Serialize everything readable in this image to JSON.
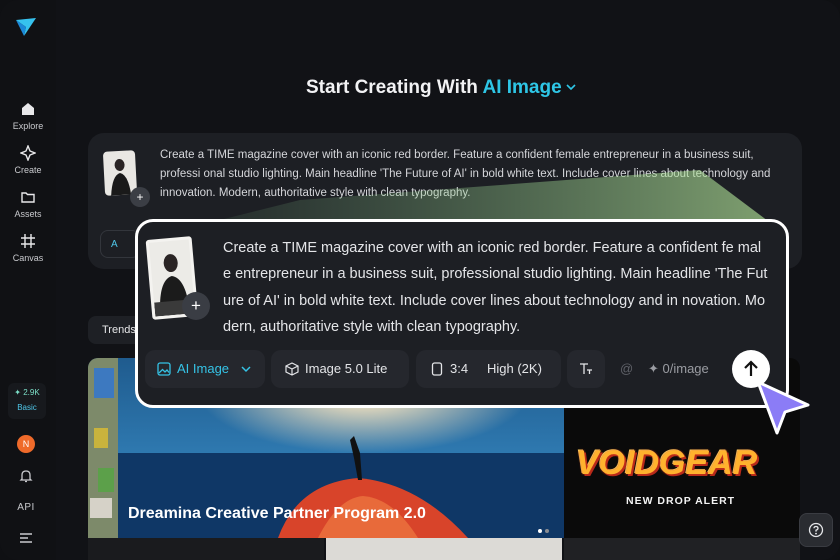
{
  "sidebar": {
    "items": [
      {
        "label": "Explore"
      },
      {
        "label": "Create"
      },
      {
        "label": "Assets"
      },
      {
        "label": "Canvas"
      }
    ],
    "credits": {
      "value": "2.9K",
      "plan": "Basic"
    },
    "avatar_initial": "N",
    "api_label": "API"
  },
  "header": {
    "title_prefix": "Start Creating With",
    "title_accent": "AI Image"
  },
  "prompt": {
    "text_small": "Create a TIME magazine cover with an iconic red border. Feature a confident female entrepreneur in a business suit, professi onal studio lighting. Main headline 'The Future of AI' in bold white text. Include cover lines about technology and innovation. Modern, authoritative style with clean typography.",
    "text_big": "Create a TIME magazine cover with an iconic red border. Feature a confident fe male entrepreneur in a business suit, professional studio lighting. Main headline 'The Future of AI' in bold white text. Include cover lines about technology and in novation. Modern, authoritative style with clean typography.",
    "plus": "+"
  },
  "toolbar": {
    "mode_label": "AI Image",
    "mode_label_partial": "A",
    "model_label": "Image 5.0 Lite",
    "ratio_label": "3:4",
    "quality_label": "High (2K)",
    "at_symbol": "@",
    "rate_label": "0/image"
  },
  "tabs": {
    "trends_label": "Trends"
  },
  "banner": {
    "title": "Dreamina Creative Partner Program 2.0",
    "side_title": "VOIDGEAR",
    "side_subtitle": "NEW DROP ALERT"
  },
  "colors": {
    "accent": "#2ec6e6",
    "cursor": "#8b7cf6",
    "card": "#1d1f24",
    "background": "#111216"
  },
  "icons": [
    "logo-icon",
    "home-icon",
    "sparkle-icon",
    "folder-icon",
    "canvas-icon",
    "bell-icon",
    "menu-icon",
    "image-icon",
    "chevron-down-icon",
    "cube-icon",
    "ratio-icon",
    "text-size-icon",
    "arrow-up-icon",
    "help-icon",
    "cursor-icon"
  ]
}
